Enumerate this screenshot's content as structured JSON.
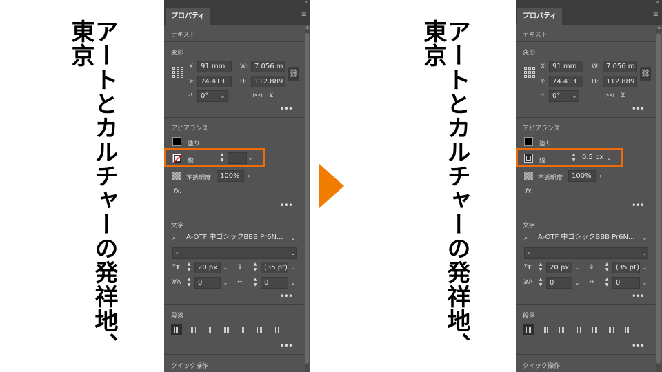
{
  "canvas_text": "アートとカルチャーの発祥地、東京",
  "panel": {
    "tab_label": "プロパティ",
    "sections": {
      "text": "テキスト",
      "transform": "変形",
      "appearance": "アピアランス",
      "character": "文字",
      "paragraph": "段落",
      "quick_actions": "クイック操作"
    },
    "transform": {
      "x_label": "X:",
      "x_value": "91 mm",
      "y_label": "Y:",
      "y_value": "74.413",
      "w_label": "W:",
      "w_value": "7.056 m",
      "h_label": "H:",
      "h_value": "112.889",
      "angle_value": "0°"
    },
    "appearance": {
      "fill_label": "塗り",
      "stroke_label": "線",
      "opacity_label": "不透明度",
      "opacity_value": "100%",
      "fx_label": "fx."
    },
    "character": {
      "font_family": "A-OTF 中ゴシックBBB Pr6N...",
      "font_style": "-",
      "font_size": "20 px",
      "leading": "(35 pt)",
      "tracking": "0",
      "kerning": "0"
    }
  },
  "before": {
    "stroke_weight": ""
  },
  "after": {
    "stroke_weight": "0.5 px"
  },
  "colors": {
    "highlight": "#ec6c0a",
    "panel_bg": "#535353"
  }
}
